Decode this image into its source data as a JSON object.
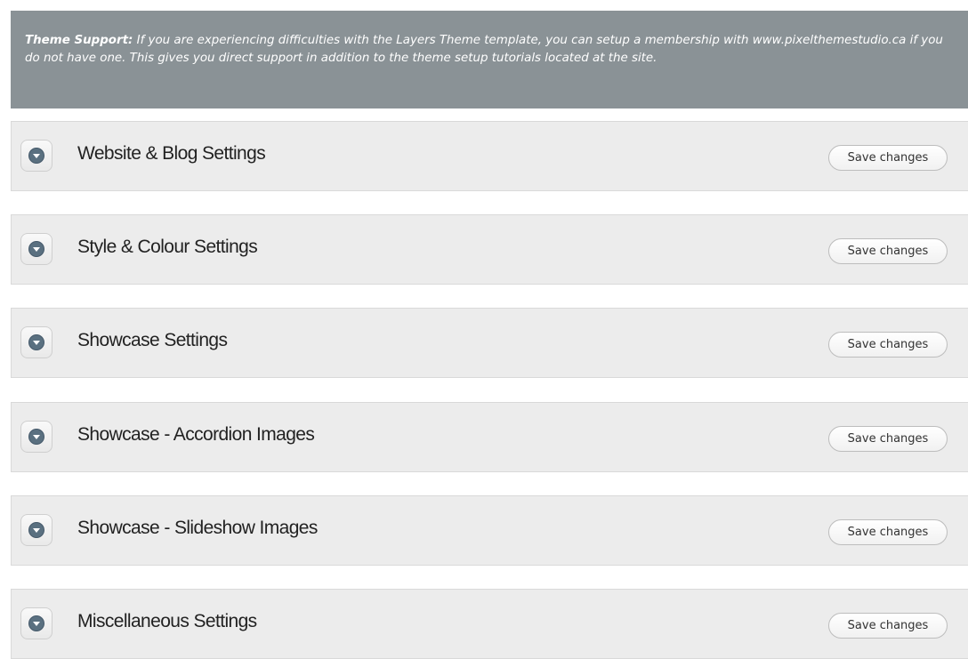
{
  "notice": {
    "label": "Theme Support:",
    "text": " If you are experiencing difficulties with the Layers Theme template, you can setup a membership with www.pixelthemestudio.ca if you do not have one. This gives you direct support in addition to the theme setup tutorials located at the site."
  },
  "sections": [
    {
      "title": "Website & Blog Settings",
      "save_label": "Save changes"
    },
    {
      "title": "Style & Colour Settings",
      "save_label": "Save changes"
    },
    {
      "title": "Showcase Settings",
      "save_label": "Save changes"
    },
    {
      "title": "Showcase - Accordion Images",
      "save_label": "Save changes"
    },
    {
      "title": "Showcase - Slideshow Images",
      "save_label": "Save changes"
    },
    {
      "title": "Miscellaneous Settings",
      "save_label": "Save changes"
    }
  ],
  "icons": {
    "toggle": "expand-arrow-icon"
  },
  "colors": {
    "notice_background": "#8a9296",
    "section_background": "#ececec",
    "toggle_icon": "#5a7080"
  }
}
